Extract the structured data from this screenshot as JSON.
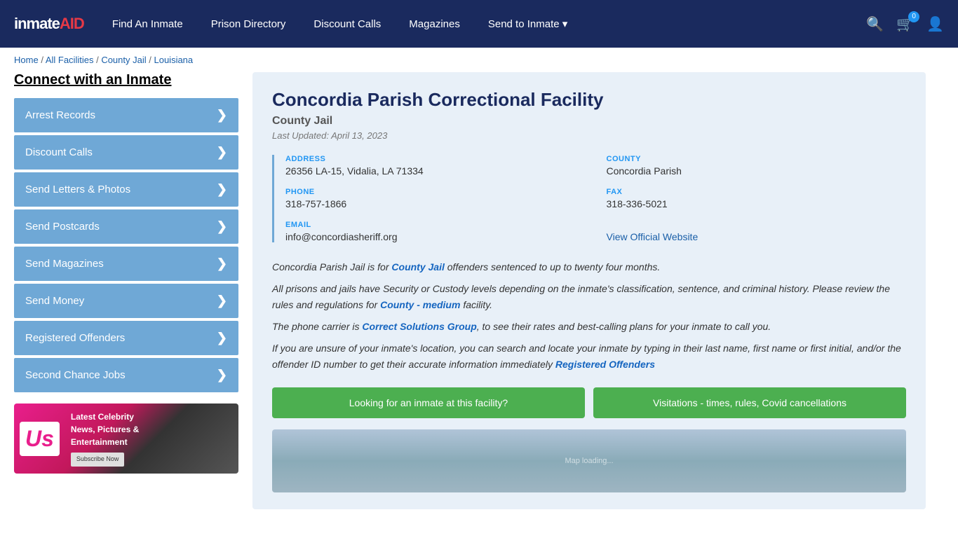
{
  "header": {
    "logo": "inmateAID",
    "nav": {
      "find_inmate": "Find An Inmate",
      "prison_directory": "Prison Directory",
      "discount_calls": "Discount Calls",
      "magazines": "Magazines",
      "send_to_inmate": "Send to Inmate ▾"
    },
    "cart_count": "0"
  },
  "breadcrumb": {
    "home": "Home",
    "all_facilities": "All Facilities",
    "county_jail": "County Jail",
    "state": "Louisiana"
  },
  "sidebar": {
    "title": "Connect with an Inmate",
    "items": [
      {
        "label": "Arrest Records"
      },
      {
        "label": "Discount Calls"
      },
      {
        "label": "Send Letters & Photos"
      },
      {
        "label": "Send Postcards"
      },
      {
        "label": "Send Magazines"
      },
      {
        "label": "Send Money"
      },
      {
        "label": "Registered Offenders"
      },
      {
        "label": "Second Chance Jobs"
      }
    ]
  },
  "facility": {
    "title": "Concordia Parish Correctional Facility",
    "type": "County Jail",
    "last_updated": "Last Updated: April 13, 2023",
    "address_label": "ADDRESS",
    "address_value": "26356 LA-15, Vidalia, LA 71334",
    "county_label": "COUNTY",
    "county_value": "Concordia Parish",
    "phone_label": "PHONE",
    "phone_value": "318-757-1866",
    "fax_label": "FAX",
    "fax_value": "318-336-5021",
    "email_label": "EMAIL",
    "email_value": "info@concordiasheriff.org",
    "website_link": "View Official Website",
    "desc1": "Concordia Parish Jail is for County Jail offenders sentenced to up to twenty four months.",
    "desc2": "All prisons and jails have Security or Custody levels depending on the inmate's classification, sentence, and criminal history. Please review the rules and regulations for County - medium facility.",
    "desc3": "The phone carrier is Correct Solutions Group, to see their rates and best-calling plans for your inmate to call you.",
    "desc4": "If you are unsure of your inmate's location, you can search and locate your inmate by typing in their last name, first name or first initial, and/or the offender ID number to get their accurate information immediately Registered Offenders",
    "btn1": "Looking for an inmate at this facility?",
    "btn2": "Visitations - times, rules, Covid cancellations"
  }
}
